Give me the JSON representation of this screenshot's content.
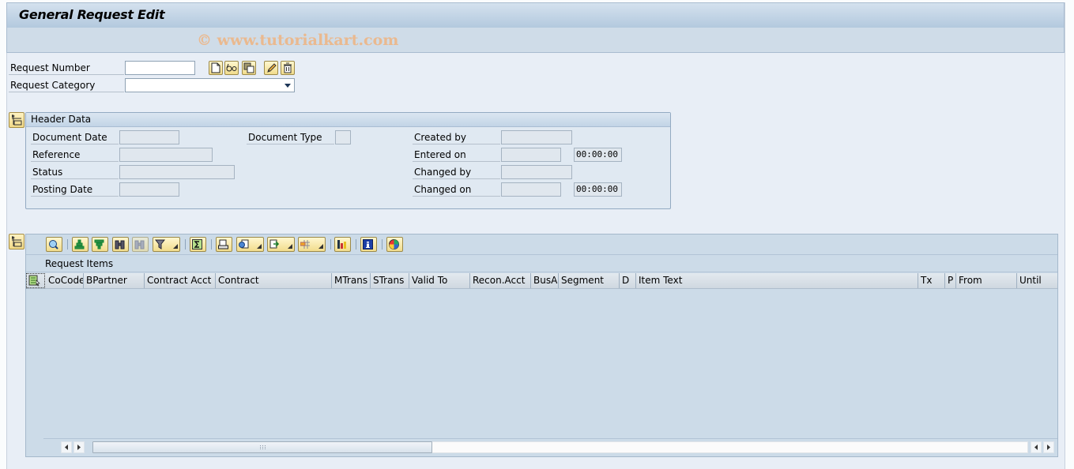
{
  "window": {
    "title": "General Request Edit",
    "watermark": "© www.tutorialkart.com"
  },
  "selection": {
    "request_number_label": "Request Number",
    "request_number_value": "",
    "request_category_label": "Request Category",
    "request_category_value": "",
    "buttons": [
      {
        "name": "create",
        "icon": "new-document-icon"
      },
      {
        "name": "display",
        "icon": "glasses-icon"
      },
      {
        "name": "copy",
        "icon": "copy-icon"
      },
      {
        "name": "change",
        "icon": "pencil-icon"
      },
      {
        "name": "delete",
        "icon": "trash-icon"
      }
    ]
  },
  "header_data": {
    "title": "Header Data",
    "document_date_label": "Document Date",
    "document_date_value": "",
    "document_type_label": "Document Type",
    "document_type_value": "",
    "reference_label": "Reference",
    "reference_value": "",
    "status_label": "Status",
    "status_value": "",
    "posting_date_label": "Posting Date",
    "posting_date_value": "",
    "created_by_label": "Created by",
    "created_by_value": "",
    "entered_on_label": "Entered on",
    "entered_on_date": "",
    "entered_on_time": "00:00:00",
    "changed_by_label": "Changed by",
    "changed_by_value": "",
    "changed_on_label": "Changed on",
    "changed_on_date": "",
    "changed_on_time": "00:00:00"
  },
  "items": {
    "title": "Request Items",
    "toolbar": [
      "details-icon",
      "sort-ascending-icon",
      "sort-descending-icon",
      "find-icon",
      "find-next-icon",
      "filter-icon",
      "sum-icon",
      "print-preview-icon",
      "views-icon",
      "export-icon",
      "layout-icon",
      "graphic-icon",
      "info-icon",
      "abc-analysis-icon"
    ],
    "columns": [
      "CoCode",
      "BPartner",
      "Contract Acct",
      "Contract",
      "MTrans",
      "STrans",
      "Valid To",
      "Recon.Acct",
      "BusA",
      "Segment",
      "D",
      "Item Text",
      "Tx",
      "P",
      "From",
      "Until"
    ],
    "rows": []
  }
}
